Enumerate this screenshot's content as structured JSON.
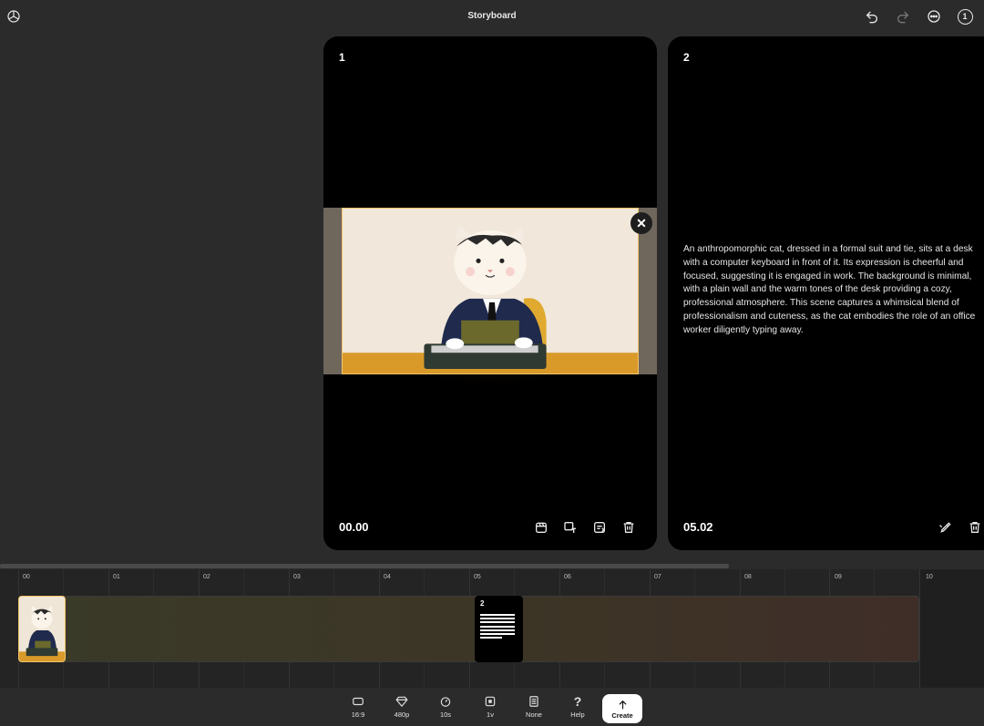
{
  "header": {
    "title": "Storyboard",
    "badge_count": "1"
  },
  "cards": [
    {
      "number": "1",
      "time": "00.00"
    },
    {
      "number": "2",
      "time": "05.02",
      "description": "An anthropomorphic cat, dressed in a formal suit and tie, sits at a desk with a computer keyboard in front of it. Its expression is cheerful and focused, suggesting it is engaged in work. The background is minimal, with a plain wall and the warm tones of the desk providing a cozy, professional atmosphere. This scene captures a whimsical blend of professionalism and cuteness, as the cat embodies the role of an office worker diligently typing away."
    }
  ],
  "timeline": {
    "ticks": [
      "00",
      "01",
      "02",
      "03",
      "04",
      "05",
      "06",
      "07",
      "08",
      "09",
      "10"
    ],
    "thumb2_number": "2"
  },
  "toolbar": {
    "aspect": "16:9",
    "resolution": "480p",
    "duration": "10s",
    "variations": "1v",
    "style": "None",
    "help": "Help",
    "create": "Create"
  },
  "colors": {
    "accent": "#f2c46a",
    "background": "#2b2b2b",
    "card": "#000000"
  }
}
